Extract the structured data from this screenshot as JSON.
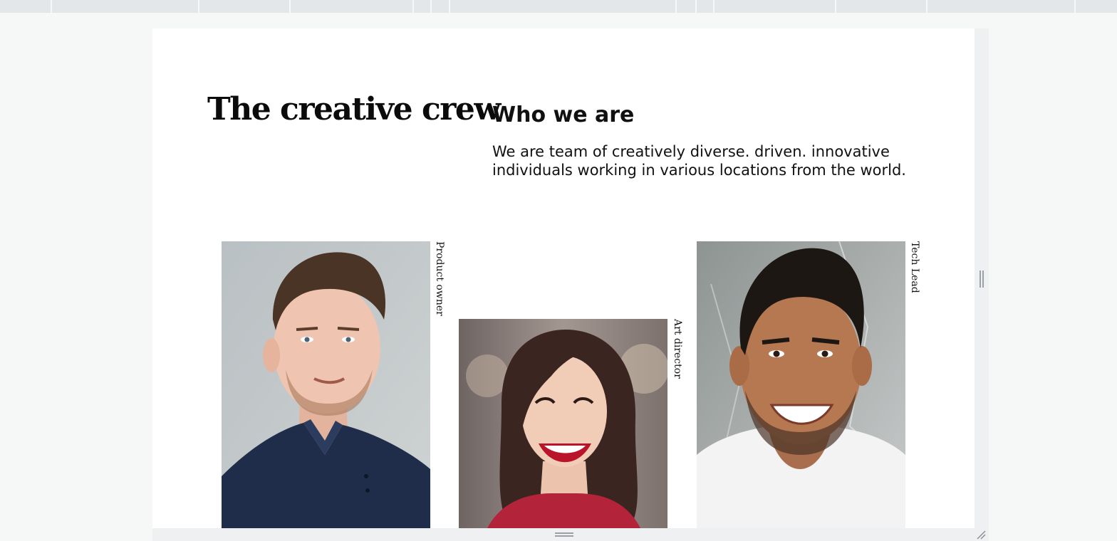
{
  "page": {
    "title": "The creative crew",
    "about": {
      "heading": "Who we are",
      "text": "We are team of creatively diverse. driven. innovative individuals working in various locations from the world."
    }
  },
  "team": [
    {
      "role": "Product owner",
      "photo": "man-portrait-photo"
    },
    {
      "role": "Art director",
      "photo": "woman-portrait-photo"
    },
    {
      "role": "Tech Lead",
      "photo": "man-smiling-portrait-photo"
    }
  ],
  "editor": {
    "resize_handles": [
      "right-resize-handle",
      "bottom-resize-handle",
      "corner-resize-icon"
    ]
  }
}
